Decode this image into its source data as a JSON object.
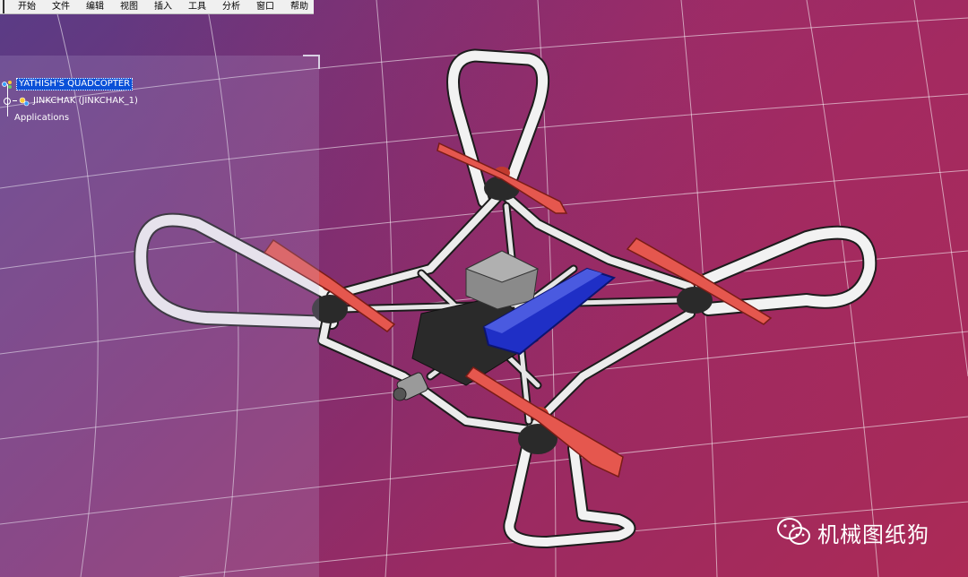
{
  "menu": {
    "items": [
      "开始",
      "文件",
      "编辑",
      "视图",
      "插入",
      "工具",
      "分析",
      "窗口",
      "帮助"
    ]
  },
  "tree": {
    "root_label": "YATHISH'S QUADCOPTER",
    "child_label": "JINKCHAK (JINKCHAK_1)",
    "applications_label": "Applications"
  },
  "model": {
    "frame_icon": "quadcopter-frame",
    "battery_color": "#1f2fc6",
    "propeller_color": "#e5574e",
    "frame_color": "#f2f2f2"
  },
  "watermark": {
    "text": "机械图纸狗",
    "icon": "wechat-icon"
  },
  "colors": {
    "menu_bg": "#f0f0f0",
    "selection": "#0a50d8"
  }
}
